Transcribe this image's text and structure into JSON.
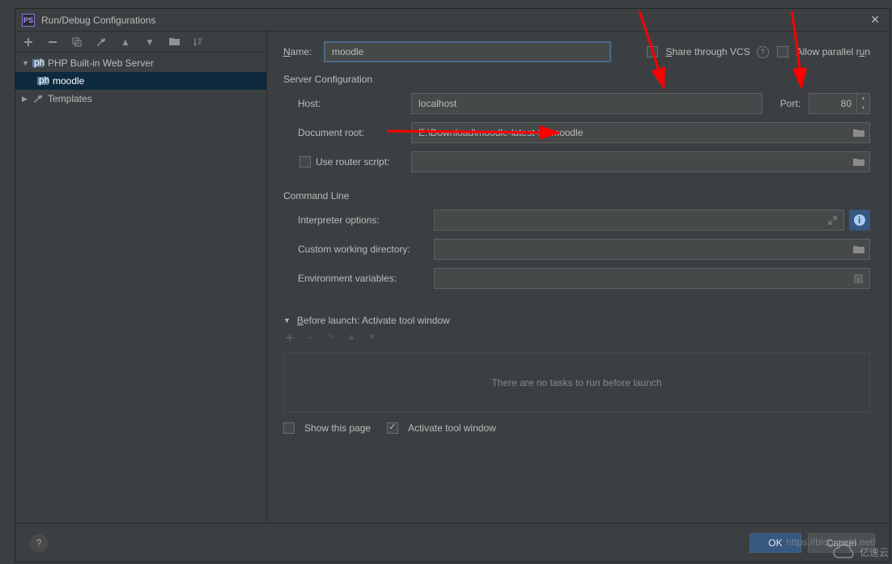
{
  "title": "Run/Debug Configurations",
  "sidebar": {
    "root": {
      "label": "PHP Built-in Web Server"
    },
    "child": {
      "label": "moodle"
    },
    "templates": {
      "label": "Templates"
    }
  },
  "form": {
    "name_label": "Name:",
    "name_value": "moodle",
    "share_label": "Share through VCS",
    "parallel_label": "Allow parallel run",
    "server_section": "Server Configuration",
    "host_label": "Host:",
    "host_value": "localhost",
    "port_label": "Port:",
    "port_value": "80",
    "docroot_label": "Document root:",
    "docroot_value": "E:\\Download\\moodle-latest-37\\moodle",
    "router_label": "Use router script:",
    "cmdline_section": "Command Line",
    "interpopt_label": "Interpreter options:",
    "cwd_label": "Custom working directory:",
    "env_label": "Environment variables:",
    "before_launch": "Before launch: Activate tool window",
    "no_tasks": "There are no tasks to run before launch",
    "show_page": "Show this page",
    "activate_tool": "Activate tool window"
  },
  "buttons": {
    "ok": "OK",
    "cancel": "Cancel"
  },
  "watermark": {
    "text": "亿速云",
    "url": "https://blog.csdn.net/"
  }
}
